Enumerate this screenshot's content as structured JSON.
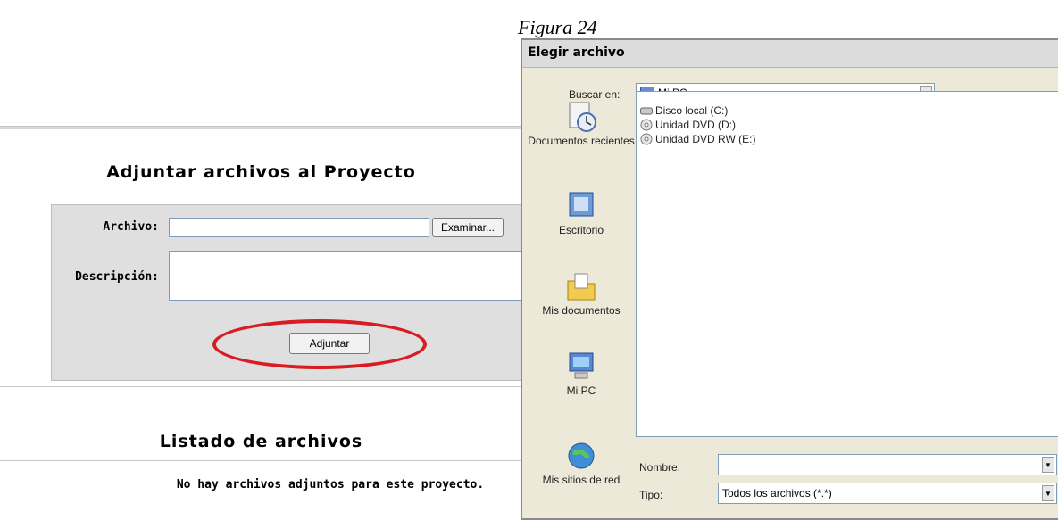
{
  "caption": "Figura 24",
  "web": {
    "section_title": "Adjuntar archivos al Proyecto",
    "archivo_label": "Archivo:",
    "descripcion_label": "Descripción:",
    "browse_label": "Examinar...",
    "attach_label": "Adjuntar",
    "list_title": "Listado de archivos",
    "empty_message": "No hay archivos adjuntos para este proyecto."
  },
  "dialog": {
    "title": "Elegir archivo",
    "look_in_label": "Buscar en:",
    "look_in_value": "Mi PC",
    "places": [
      {
        "label": "Documentos recientes",
        "icon": "recent-documents-icon"
      },
      {
        "label": "Escritorio",
        "icon": "desktop-icon"
      },
      {
        "label": "Mis documentos",
        "icon": "my-documents-icon"
      },
      {
        "label": "Mi PC",
        "icon": "my-computer-icon"
      },
      {
        "label": "Mis sitios de red",
        "icon": "network-places-icon"
      }
    ],
    "files": [
      {
        "name": "Disco local (C:)",
        "icon": "hard-drive-icon"
      },
      {
        "name": "Unidad DVD (D:)",
        "icon": "dvd-drive-icon"
      },
      {
        "name": "Unidad DVD RW (E:)",
        "icon": "dvd-drive-icon"
      }
    ],
    "name_label": "Nombre:",
    "name_value": "",
    "type_label": "Tipo:",
    "type_value": "Todos los archivos (*.*)"
  }
}
